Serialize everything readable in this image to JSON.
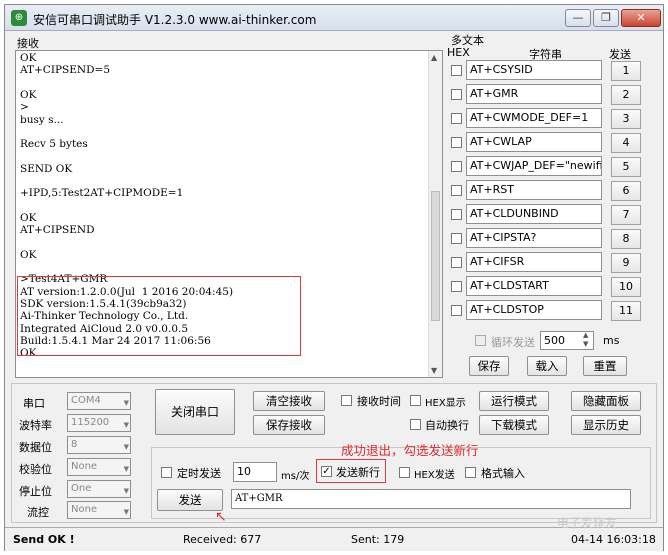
{
  "window": {
    "title": "安信可串口调试助手 V1.2.3.0    www.ai-thinker.com",
    "controls": [
      "—",
      "❐",
      "✕"
    ]
  },
  "receive": {
    "label": "接收",
    "lines": [
      "OK",
      "AT+CIPSEND=5",
      "",
      "OK",
      ">",
      "busy s...",
      "",
      "Recv 5 bytes",
      "",
      "SEND OK",
      "",
      "+IPD,5:Test2AT+CIPMODE=1",
      "",
      "OK",
      "AT+CIPSEND",
      "",
      "OK",
      "",
      ">Test4AT+GMR",
      "AT version:1.2.0.0(Jul  1 2016 20:04:45)",
      "SDK version:1.5.4.1(39cb9a32)",
      "Ai-Thinker Technology Co., Ltd.",
      "Integrated AiCloud 2.0 v0.0.0.5",
      "Build:1.5.4.1 Mar 24 2017 11:06:56",
      "OK"
    ]
  },
  "multi": {
    "group_label": "多文本",
    "hex_header": "HEX",
    "string_header": "字符串",
    "send_header": "发送",
    "rows": [
      {
        "cmd": "AT+CSYSID",
        "num": "1"
      },
      {
        "cmd": "AT+GMR",
        "num": "2"
      },
      {
        "cmd": "AT+CWMODE_DEF=1",
        "num": "3"
      },
      {
        "cmd": "AT+CWLAP",
        "num": "4"
      },
      {
        "cmd": "AT+CWJAP_DEF=\"newifi_",
        "num": "5"
      },
      {
        "cmd": "AT+RST",
        "num": "6"
      },
      {
        "cmd": "AT+CLDUNBIND",
        "num": "7"
      },
      {
        "cmd": "AT+CIPSTA?",
        "num": "8"
      },
      {
        "cmd": "AT+CIFSR",
        "num": "9"
      },
      {
        "cmd": "AT+CLDSTART",
        "num": "10"
      },
      {
        "cmd": "AT+CLDSTOP",
        "num": "11"
      }
    ],
    "loop_send_label": "循环发送",
    "loop_ms_value": "500",
    "ms_label": "ms",
    "save_label": "保存",
    "load_label": "载入",
    "reset_label": "重置"
  },
  "serial": {
    "port_label": "串口",
    "port_value": "COM4",
    "baud_label": "波特率",
    "baud_value": "115200",
    "databits_label": "数据位",
    "databits_value": "8",
    "parity_label": "校验位",
    "parity_value": "None",
    "stopbits_label": "停止位",
    "stopbits_value": "One",
    "flow_label": "流控",
    "flow_value": "None"
  },
  "controls": {
    "close_port": "关闭串口",
    "clear_recv": "清空接收",
    "save_recv": "保存接收",
    "recv_time": "接收时间",
    "hex_display": "HEX显示",
    "auto_wrap": "自动换行",
    "run_mode": "运行模式",
    "download_mode": "下载模式",
    "hide_panel": "隐藏面板",
    "show_history": "显示历史",
    "timed_send": "定时发送",
    "interval_value": "10",
    "interval_unit": "ms/次",
    "send_newline": "发送新行",
    "hex_send": "HEX发送",
    "format_input": "格式输入",
    "send_button": "发送",
    "send_input_value": "AT+GMR"
  },
  "annotation": "成功退出，勾选发送新行",
  "status": {
    "send_ok": "Send OK !",
    "received": "Received: 677",
    "sent": "Sent: 179",
    "timestamp": "04-14 16:03:18"
  },
  "watermark": "电子发烧友"
}
